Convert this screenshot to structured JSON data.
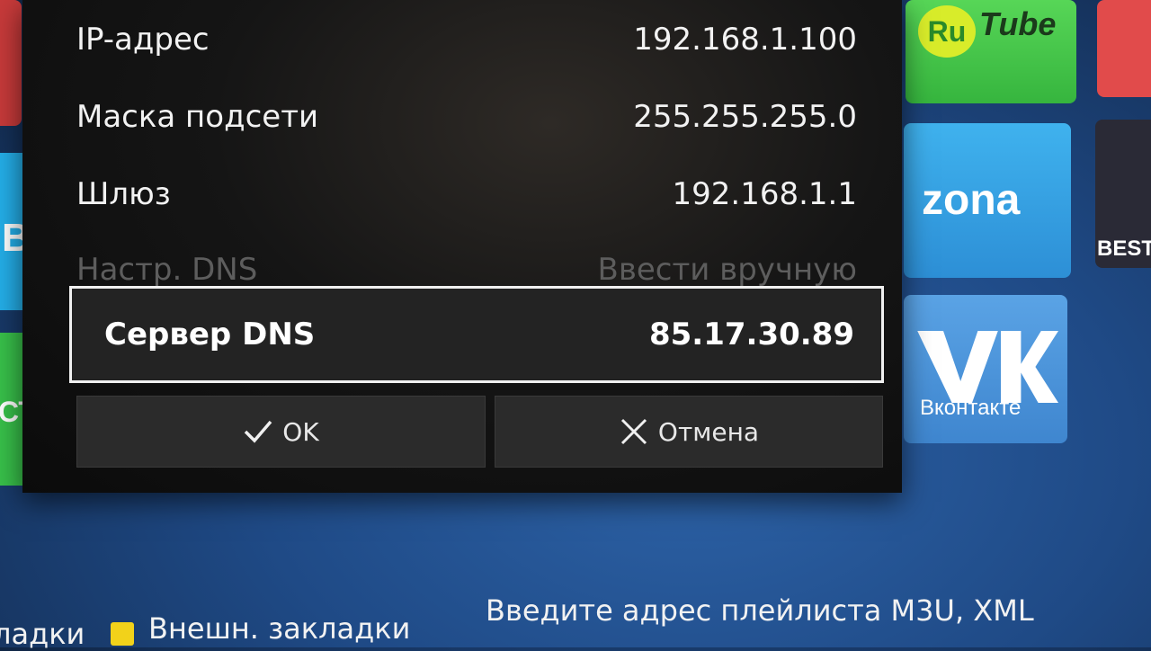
{
  "dialog": {
    "rows": [
      {
        "label": "IP-адрес",
        "value": "192.168.1.100"
      },
      {
        "label": "Маска подсети",
        "value": "255.255.255.0"
      },
      {
        "label": "Шлюз",
        "value": "192.168.1.1"
      },
      {
        "label": "Настр. DNS",
        "value": "Ввести вручную"
      },
      {
        "label": "Сервер DNS",
        "value": "85.17.30.89"
      }
    ],
    "ok_label": "OK",
    "cancel_label": "Отмена"
  },
  "apps": {
    "rutube": {
      "prefix": "Ru",
      "suffix": "Tube"
    },
    "zona": "zona",
    "vk": "Вконтакте",
    "best": "BEST",
    "left_blue": "B",
    "left_green": "СТР"
  },
  "bottom_bar": {
    "bookmarks": "ладки",
    "external_bookmarks": "Внешн. закладки",
    "playlist_hint": "Введите адрес плейлиста M3U, XML"
  },
  "colors": {
    "yellow_key": "#f2d21a",
    "background_blue": "#1f4a86"
  }
}
